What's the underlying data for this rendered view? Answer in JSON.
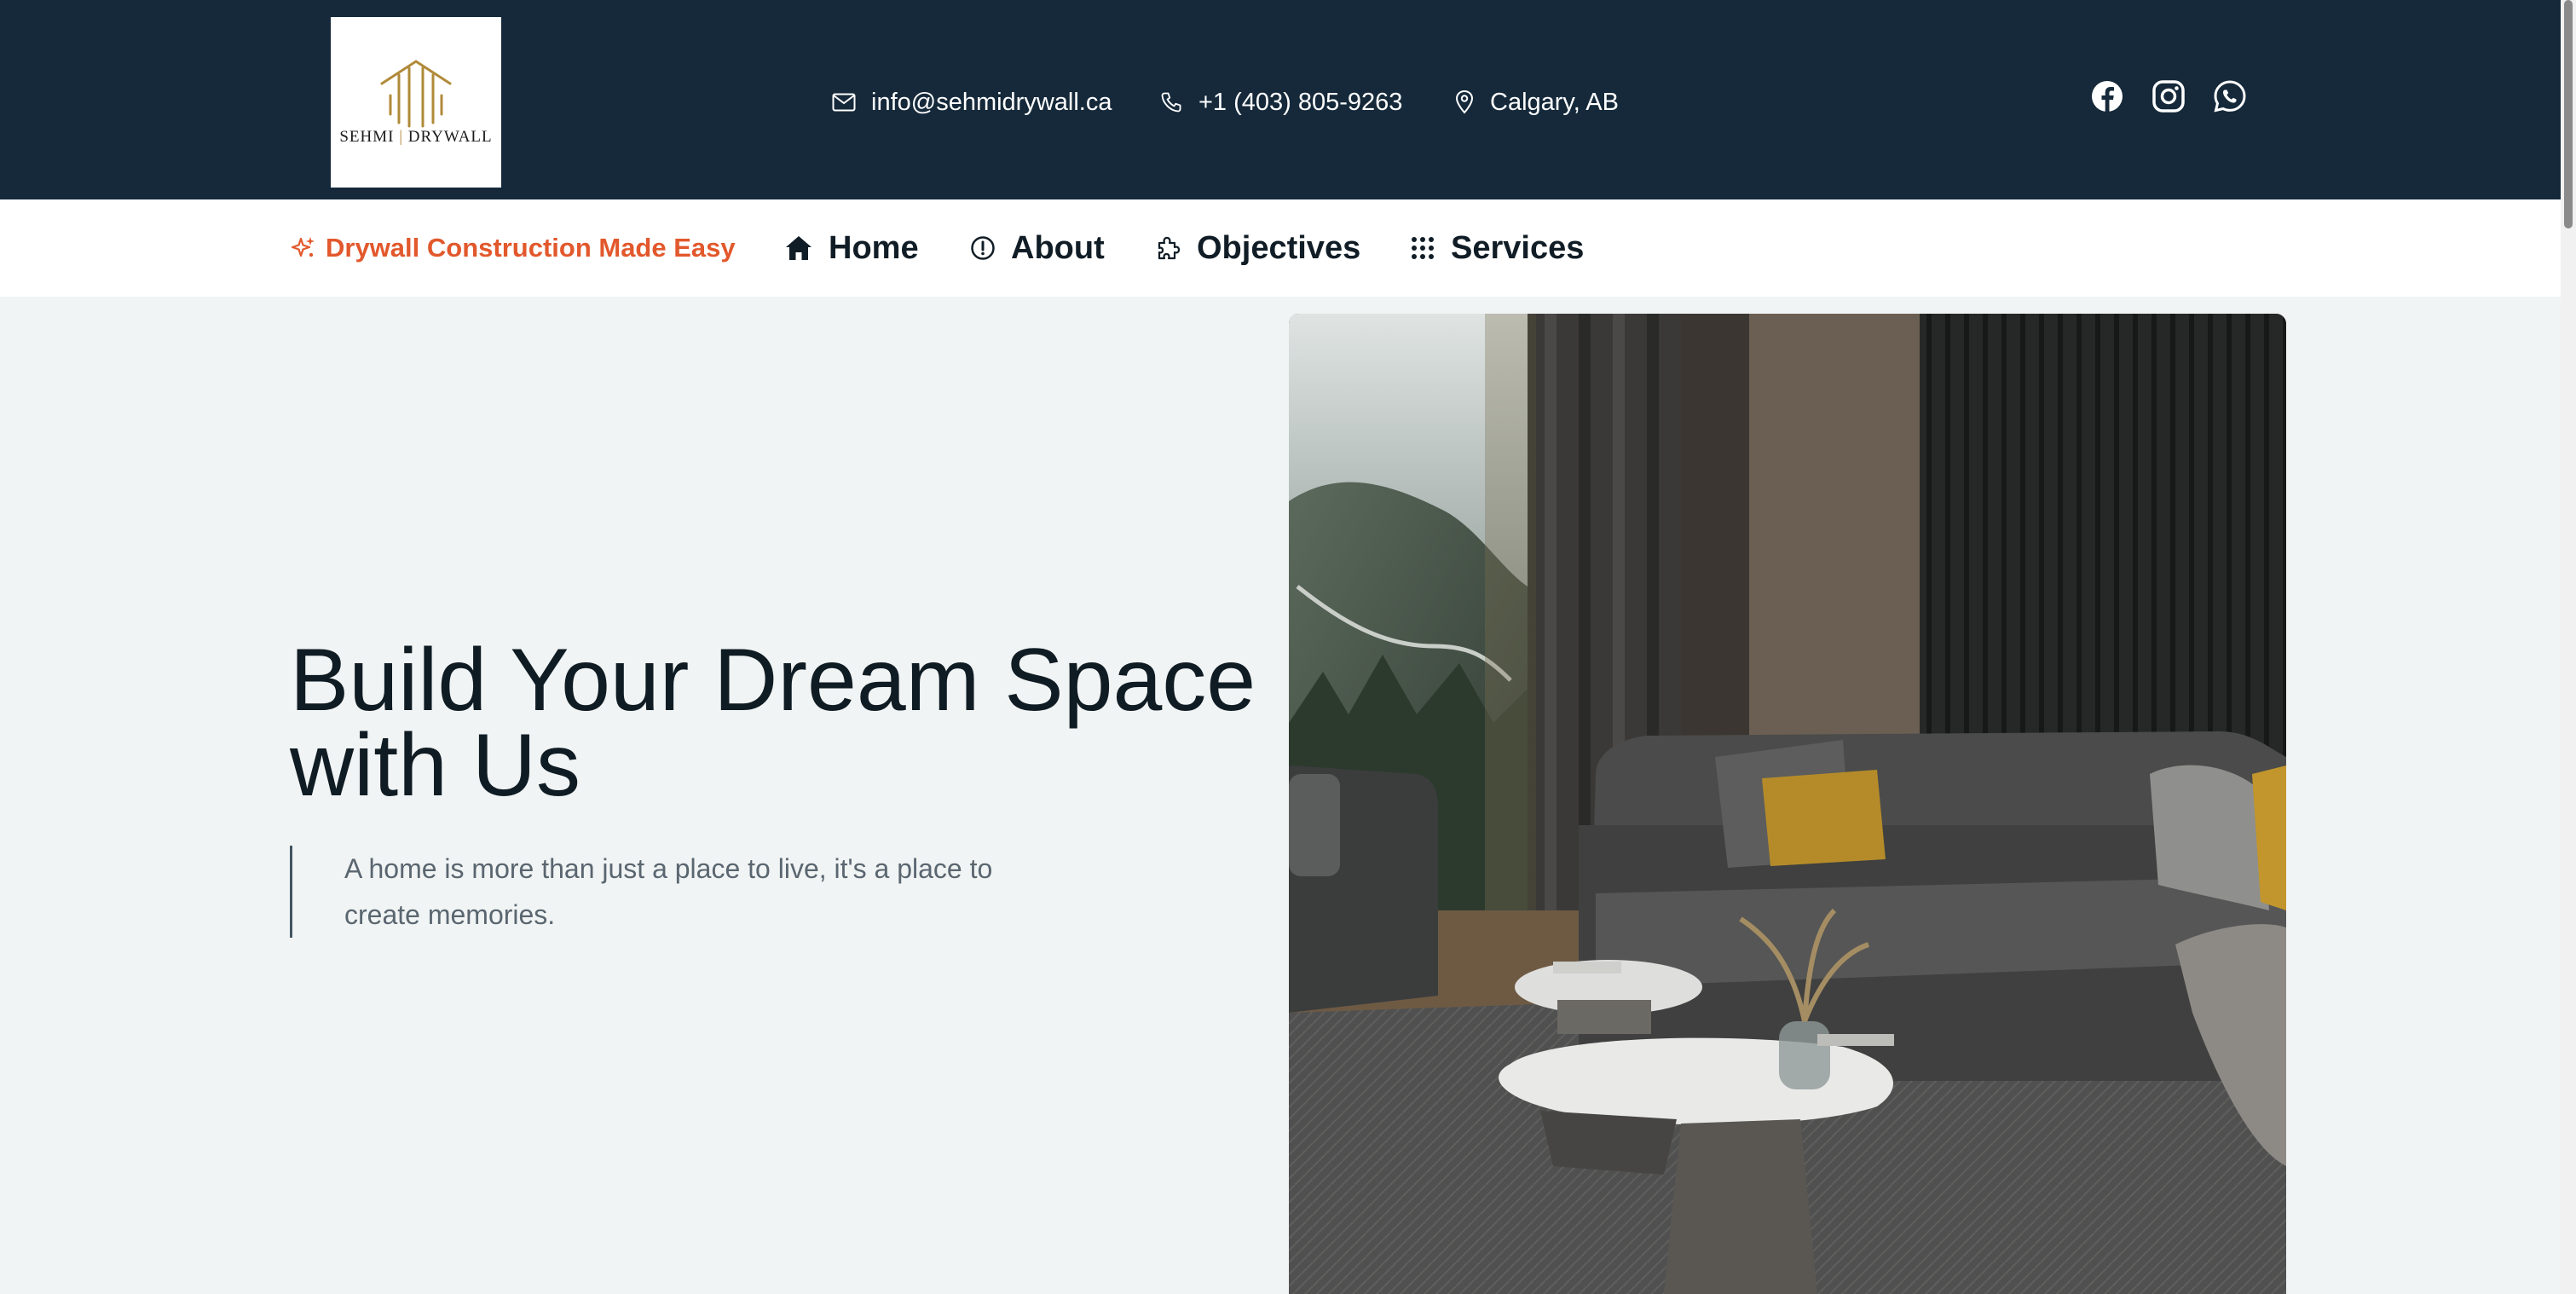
{
  "header": {
    "logo": {
      "line1": "SEHMI",
      "line2": "DRYWALL"
    },
    "contacts": [
      {
        "icon": "mail-icon",
        "text": "info@sehmidrywall.ca"
      },
      {
        "icon": "phone-icon",
        "text": "+1 (403) 805-9263"
      },
      {
        "icon": "location-pin-icon",
        "text": "Calgary, AB"
      }
    ],
    "social": [
      "facebook-icon",
      "instagram-icon",
      "whatsapp-icon"
    ]
  },
  "nav": {
    "tagline": "Drywall Construction Made Easy",
    "items": [
      {
        "label": "Home",
        "icon": "home-icon"
      },
      {
        "label": "About",
        "icon": "info-circle-icon"
      },
      {
        "label": "Objectives",
        "icon": "puzzle-icon"
      },
      {
        "label": "Services",
        "icon": "grid-dots-icon"
      }
    ]
  },
  "hero": {
    "title_line1": "Build Your Dream Space",
    "title_line2": "with Us",
    "subtitle": "A home is more than just a place to live, it's a place to create memories."
  },
  "colors": {
    "topbar": "#15293a",
    "accent": "#e2582c",
    "background": "#f1f4f4",
    "text_dark": "#101c24",
    "logo_gold": "#b08a3a"
  }
}
